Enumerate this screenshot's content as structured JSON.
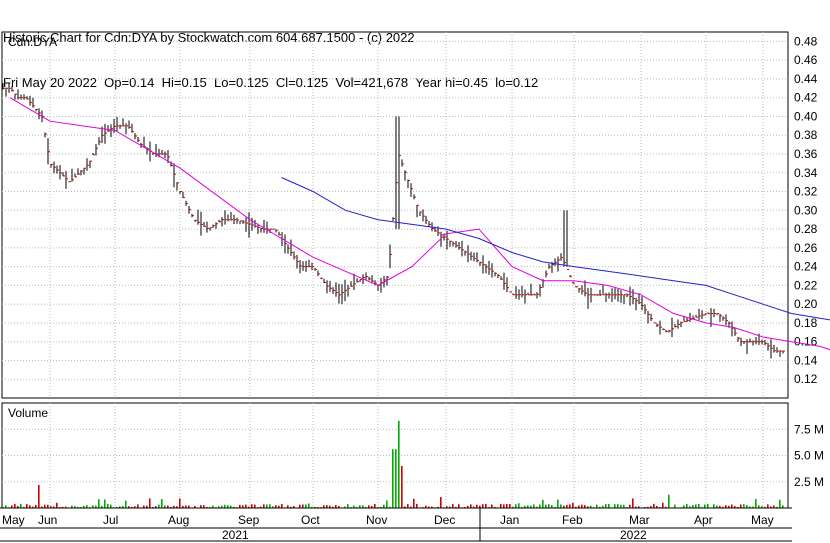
{
  "header": {
    "line1": "Historic Chart for Cdn:DYA by Stockwatch.com 604.687.1500 - (c) 2022",
    "line2": "Fri May 20 2022  Op=0.14  Hi=0.15  Lo=0.125  Cl=0.125  Vol=421,678  Year hi=0.45  lo=0.12"
  },
  "chart_data": {
    "type": "bar",
    "symbol_label": "Cdn:DYA",
    "volume_label": "Volume",
    "price_axis": {
      "ylim": [
        0.1,
        0.49
      ],
      "ticks": [
        "0.48",
        "0.46",
        "0.44",
        "0.42",
        "0.40",
        "0.38",
        "0.36",
        "0.34",
        "0.32",
        "0.30",
        "0.28",
        "0.26",
        "0.24",
        "0.22",
        "0.20",
        "0.18",
        "0.16",
        "0.14",
        "0.12"
      ]
    },
    "volume_axis": {
      "ylim": [
        0,
        10
      ],
      "ticks": [
        "7.5 M",
        "5.0 M",
        "2.5 M"
      ]
    },
    "month_labels": [
      "May",
      "Jun",
      "Jul",
      "Aug",
      "Sep",
      "Oct",
      "Nov",
      "Dec",
      "Jan",
      "Feb",
      "Mar",
      "Apr",
      "May"
    ],
    "year_labels": [
      "2021",
      "2022"
    ],
    "grid": true,
    "colors": {
      "bar": "#000000",
      "close_tick": "#cc0000",
      "ma_short": "#e000e0",
      "ma_long": "#2222cc",
      "vol_up": "#00aa00",
      "vol_down": "#cc0000",
      "grid": "#bbbbbb"
    },
    "price_path": [
      [
        0,
        0.43
      ],
      [
        0.2,
        0.42
      ],
      [
        0.4,
        0.42
      ],
      [
        0.6,
        0.41
      ],
      [
        0.8,
        0.4
      ],
      [
        1,
        0.35
      ],
      [
        1.3,
        0.33
      ],
      [
        1.6,
        0.35
      ],
      [
        1.8,
        0.38
      ],
      [
        2,
        0.39
      ],
      [
        2.2,
        0.39
      ],
      [
        2.4,
        0.37
      ],
      [
        2.6,
        0.36
      ],
      [
        2.8,
        0.36
      ],
      [
        3,
        0.32
      ],
      [
        3.2,
        0.29
      ],
      [
        3.4,
        0.28
      ],
      [
        3.6,
        0.29
      ],
      [
        3.8,
        0.29
      ],
      [
        4,
        0.285
      ],
      [
        4.2,
        0.28
      ],
      [
        4.4,
        0.28
      ],
      [
        4.6,
        0.26
      ],
      [
        4.8,
        0.24
      ],
      [
        5,
        0.24
      ],
      [
        5.2,
        0.22
      ],
      [
        5.4,
        0.21
      ],
      [
        5.6,
        0.22
      ],
      [
        5.8,
        0.23
      ],
      [
        6,
        0.22
      ],
      [
        6.15,
        0.23
      ],
      [
        6.3,
        0.36
      ],
      [
        6.4,
        0.34
      ],
      [
        6.6,
        0.3
      ],
      [
        6.8,
        0.28
      ],
      [
        7,
        0.27
      ],
      [
        7.2,
        0.26
      ],
      [
        7.4,
        0.25
      ],
      [
        7.6,
        0.24
      ],
      [
        7.8,
        0.23
      ],
      [
        8,
        0.21
      ],
      [
        8.2,
        0.21
      ],
      [
        8.4,
        0.21
      ],
      [
        8.6,
        0.24
      ],
      [
        8.8,
        0.25
      ],
      [
        9,
        0.22
      ],
      [
        9.2,
        0.21
      ],
      [
        9.4,
        0.21
      ],
      [
        9.6,
        0.21
      ],
      [
        9.8,
        0.21
      ],
      [
        10,
        0.2
      ],
      [
        10.2,
        0.18
      ],
      [
        10.4,
        0.17
      ],
      [
        10.6,
        0.18
      ],
      [
        10.8,
        0.185
      ],
      [
        11,
        0.19
      ],
      [
        11.2,
        0.19
      ],
      [
        11.4,
        0.18
      ],
      [
        11.6,
        0.16
      ],
      [
        11.8,
        0.16
      ],
      [
        12,
        0.16
      ],
      [
        12.2,
        0.15
      ],
      [
        12.4,
        0.15
      ],
      [
        12.6,
        0.16
      ],
      [
        12.8,
        0.14
      ],
      [
        13,
        0.135
      ],
      [
        13.2,
        0.13
      ],
      [
        13.4,
        0.13
      ],
      [
        13.5,
        0.13
      ],
      [
        13.6,
        0.13
      ],
      [
        13.8,
        0.14
      ],
      [
        13.95,
        0.125
      ]
    ],
    "ma_short": [
      [
        0,
        0.42
      ],
      [
        1,
        0.395
      ],
      [
        2,
        0.385
      ],
      [
        3,
        0.345
      ],
      [
        4,
        0.29
      ],
      [
        5,
        0.25
      ],
      [
        6,
        0.22
      ],
      [
        6.5,
        0.24
      ],
      [
        7,
        0.275
      ],
      [
        7.5,
        0.28
      ],
      [
        8,
        0.24
      ],
      [
        8.5,
        0.225
      ],
      [
        9,
        0.225
      ],
      [
        9.5,
        0.22
      ],
      [
        10,
        0.21
      ],
      [
        10.5,
        0.19
      ],
      [
        11,
        0.18
      ],
      [
        11.5,
        0.175
      ],
      [
        12,
        0.165
      ],
      [
        12.5,
        0.16
      ],
      [
        13,
        0.155
      ],
      [
        13.5,
        0.145
      ],
      [
        13.95,
        0.143
      ]
    ],
    "ma_long": [
      [
        4.5,
        0.335
      ],
      [
        5,
        0.32
      ],
      [
        5.5,
        0.3
      ],
      [
        6,
        0.29
      ],
      [
        6.5,
        0.285
      ],
      [
        7,
        0.28
      ],
      [
        7.5,
        0.27
      ],
      [
        8,
        0.255
      ],
      [
        8.5,
        0.245
      ],
      [
        9,
        0.24
      ],
      [
        9.5,
        0.235
      ],
      [
        10,
        0.23
      ],
      [
        10.5,
        0.225
      ],
      [
        11,
        0.22
      ],
      [
        11.5,
        0.21
      ],
      [
        12,
        0.2
      ],
      [
        12.5,
        0.19
      ],
      [
        13,
        0.185
      ],
      [
        13.5,
        0.18
      ],
      [
        13.95,
        0.176
      ]
    ]
  }
}
